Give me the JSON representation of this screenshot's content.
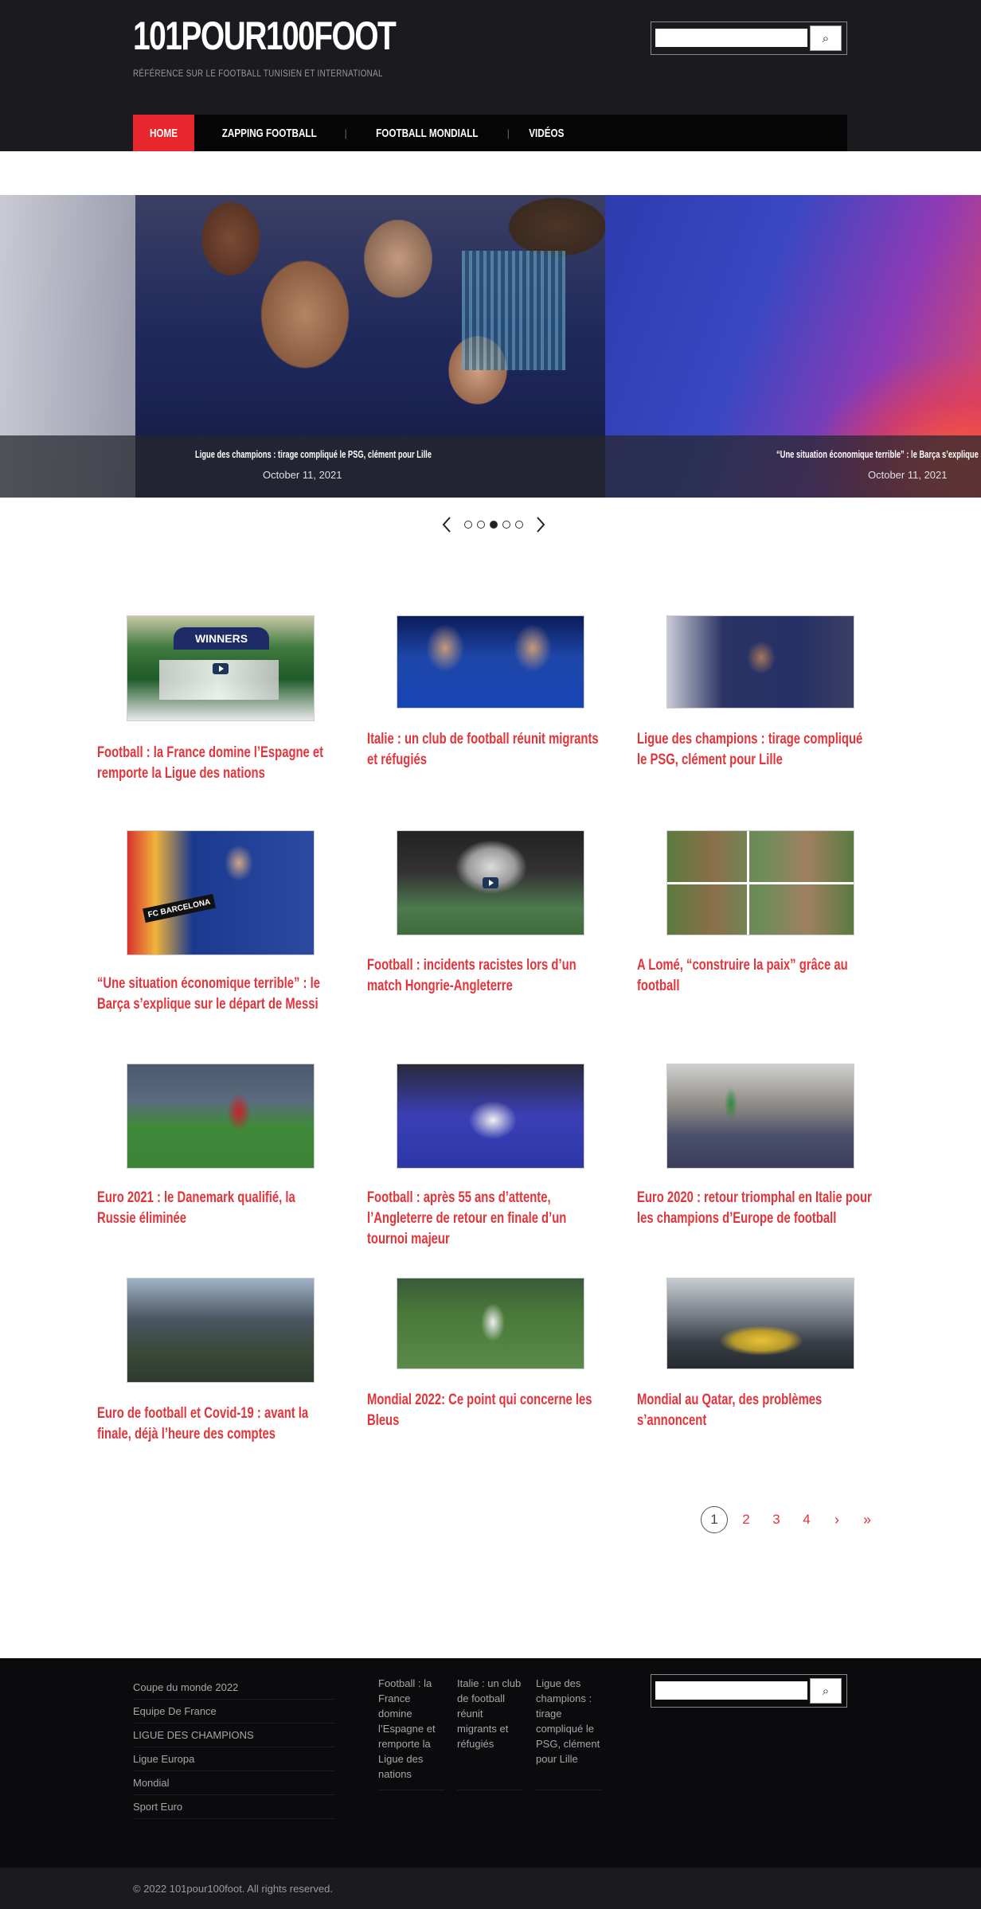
{
  "site": {
    "logo": "101POUR100FOOT",
    "tagline": "RÉFÉRENCE SUR LE FOOTBALL TUNISIEN ET INTERNATIONAL"
  },
  "search": {
    "placeholder": "",
    "button_icon": "search-icon"
  },
  "nav": {
    "items": [
      {
        "label": "HOME",
        "active": true
      },
      {
        "label": "ZAPPING FOOTBALL"
      },
      {
        "label": "FOOTBALL MONDIALL"
      },
      {
        "label": "VIDÉOS"
      }
    ]
  },
  "slider": {
    "slides": [
      {
        "title": "Ligue des champions : tirage compliqué le PSG, clément pour Lille",
        "date": "October 11, 2021"
      },
      {
        "title": "“Une situation économique terrible” : le Barça s’explique sur le départ de Messi",
        "date": "October 11, 2021"
      }
    ],
    "dot_count": 5,
    "active_dot": 3
  },
  "articles": [
    {
      "title": "Football : la France domine l’Espagne et remporte la Ligue des nations",
      "thumb_label": "WINNERS"
    },
    {
      "title": "Italie : un club de football réunit migrants et réfugiés"
    },
    {
      "title": "Ligue des champions : tirage compliqué le PSG, clément pour Lille"
    },
    {
      "title": "“Une situation économique terrible” : le Barça s’explique sur le départ de Messi",
      "thumb_label": "FC BARCELONA"
    },
    {
      "title": "Football : incidents racistes lors d’un match Hongrie-Angleterre"
    },
    {
      "title": "A Lomé, “construire la paix” grâce au football"
    },
    {
      "title": "Euro 2021 : le Danemark qualifié, la Russie éliminée"
    },
    {
      "title": "Football : après 55 ans d’attente, l’Angleterre de retour en finale d’un tournoi majeur"
    },
    {
      "title": "Euro 2020 : retour triomphal en Italie pour les champions d’Europe de football"
    },
    {
      "title": "Euro de football et Covid-19 : avant la finale, déjà l’heure des comptes"
    },
    {
      "title": "Mondial 2022: Ce point qui concerne les Bleus"
    },
    {
      "title": "Mondial au Qatar, des problèmes s’annoncent"
    }
  ],
  "pagination": {
    "current": "1",
    "pages": [
      "2",
      "3",
      "4"
    ],
    "next": "›",
    "last": "»"
  },
  "footer": {
    "categories": [
      "Coupe du monde 2022",
      "Equipe De France",
      "LIGUE DES CHAMPIONS",
      "Ligue Europa",
      "Mondial",
      "Sport Euro"
    ],
    "recent_posts": [
      "Football : la France domine l’Espagne et remporte la Ligue des nations",
      "Italie : un club de football réunit migrants et réfugiés",
      "Ligue des champions : tirage compliqué le PSG, clément pour Lille"
    ],
    "copyright": "© 2022 101pour100foot. All rights reserved."
  },
  "colors": {
    "accent": "#e2343b",
    "header_bg": "#1b1b1f",
    "footer_bg": "#0b0b0e"
  }
}
